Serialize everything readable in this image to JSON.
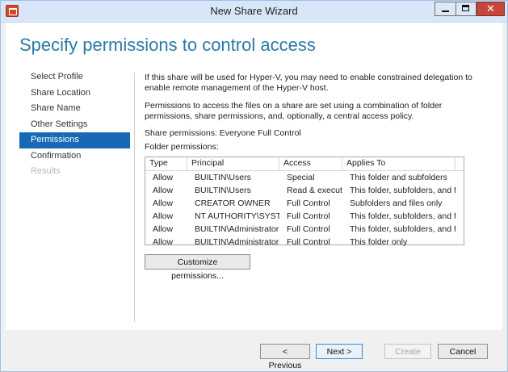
{
  "window": {
    "title": "New Share Wizard"
  },
  "page": {
    "heading": "Specify permissions to control access"
  },
  "nav": {
    "items": [
      {
        "label": "Select Profile",
        "state": "normal"
      },
      {
        "label": "Share Location",
        "state": "normal"
      },
      {
        "label": "Share Name",
        "state": "normal"
      },
      {
        "label": "Other Settings",
        "state": "normal"
      },
      {
        "label": "Permissions",
        "state": "active"
      },
      {
        "label": "Confirmation",
        "state": "normal"
      },
      {
        "label": "Results",
        "state": "disabled"
      }
    ]
  },
  "main": {
    "intro": "If this share will be used for Hyper-V, you may need to enable constrained delegation to enable remote management of the Hyper-V host.",
    "description": "Permissions to access the files on a share are set using a combination of folder permissions, share permissions, and, optionally, a central access policy.",
    "share_permissions": "Share permissions: Everyone Full Control",
    "folder_permissions_label": "Folder permissions:"
  },
  "table": {
    "columns": [
      "Type",
      "Principal",
      "Access",
      "Applies To"
    ],
    "rows": [
      [
        "Allow",
        "BUILTIN\\Users",
        "Special",
        "This folder and subfolders"
      ],
      [
        "Allow",
        "BUILTIN\\Users",
        "Read & execute",
        "This folder, subfolders, and files"
      ],
      [
        "Allow",
        "CREATOR OWNER",
        "Full Control",
        "Subfolders and files only"
      ],
      [
        "Allow",
        "NT AUTHORITY\\SYSTEM",
        "Full Control",
        "This folder, subfolders, and files"
      ],
      [
        "Allow",
        "BUILTIN\\Administrators",
        "Full Control",
        "This folder, subfolders, and files"
      ],
      [
        "Allow",
        "BUILTIN\\Administrators",
        "Full Control",
        "This folder only"
      ]
    ]
  },
  "buttons": {
    "customize": "Customize permissions...",
    "previous": "< Previous",
    "next": "Next >",
    "create": "Create",
    "cancel": "Cancel"
  },
  "colors": {
    "accent": "#1769b3",
    "heading": "#2a7aa7",
    "close_button": "#c7463c"
  },
  "icons": {
    "app": "share-wizard-icon",
    "minimize": "minimize-icon",
    "maximize": "maximize-icon",
    "close": "close-icon"
  }
}
